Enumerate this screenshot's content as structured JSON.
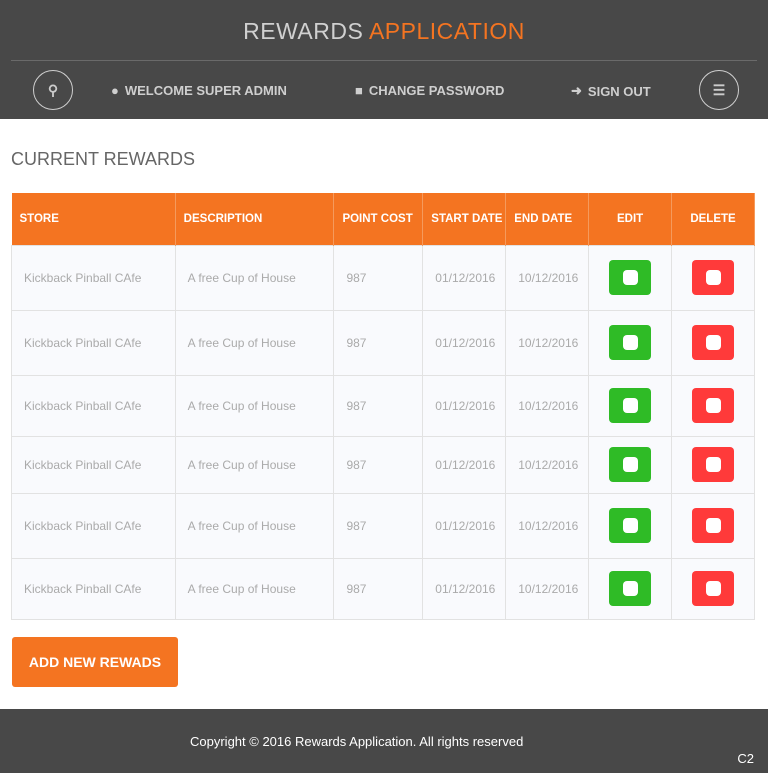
{
  "header": {
    "title_part1": "REWARDS",
    "title_part2": "APPLICATION",
    "welcome": "WELCOME SUPER ADMIN",
    "change_password": "CHANGE PASSWORD",
    "sign_out": "SIGN OUT"
  },
  "page_title": "CURRENT REWARDS",
  "table": {
    "columns": [
      "STORE",
      "DESCRIPTION",
      "POINT COST",
      "START DATE",
      "END DATE",
      "EDIT",
      "DELETE"
    ],
    "rows": [
      {
        "store": "Kickback Pinball CAfe",
        "description": "A free Cup of House",
        "cost": "987",
        "start": "01/12/2016",
        "end": "10/12/2016"
      },
      {
        "store": "Kickback Pinball CAfe",
        "description": "A free Cup of House",
        "cost": "987",
        "start": "01/12/2016",
        "end": "10/12/2016"
      },
      {
        "store": "Kickback Pinball CAfe",
        "description": "A free Cup of House",
        "cost": "987",
        "start": "01/12/2016",
        "end": "10/12/2016"
      },
      {
        "store": "Kickback Pinball CAfe",
        "description": "A free Cup of House",
        "cost": "987",
        "start": "01/12/2016",
        "end": "10/12/2016"
      },
      {
        "store": "Kickback Pinball CAfe",
        "description": "A free Cup of House",
        "cost": "987",
        "start": "01/12/2016",
        "end": "10/12/2016"
      },
      {
        "store": "Kickback Pinball CAfe",
        "description": "A free Cup of House",
        "cost": "987",
        "start": "01/12/2016",
        "end": "10/12/2016"
      }
    ]
  },
  "add_button": "ADD NEW REWADS",
  "footer": {
    "copyright": "Copyright © 2016 Rewards Application. All rights reserved",
    "code": "C2"
  },
  "colors": {
    "accent": "#f47421",
    "edit": "#2fbb26",
    "delete": "#ff3a3a",
    "header_bg": "#484848"
  }
}
